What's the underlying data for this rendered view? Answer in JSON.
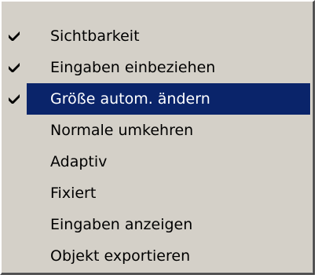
{
  "menu": {
    "items": [
      {
        "label": "Sichtbarkeit",
        "checked": true,
        "selected": false,
        "icon": "checkmark-icon"
      },
      {
        "label": "Eingaben einbeziehen",
        "checked": true,
        "selected": false,
        "icon": "checkmark-icon"
      },
      {
        "label": "Größe autom. ändern",
        "checked": true,
        "selected": true,
        "icon": "checkmark-icon"
      },
      {
        "label": "Normale umkehren",
        "checked": false,
        "selected": false
      },
      {
        "label": "Adaptiv",
        "checked": false,
        "selected": false
      },
      {
        "label": "Fixiert",
        "checked": false,
        "selected": false
      },
      {
        "label": "Eingaben anzeigen",
        "checked": false,
        "selected": false
      },
      {
        "label": "Objekt exportieren",
        "checked": false,
        "selected": false
      }
    ]
  },
  "colors": {
    "menu_background": "#d4d0c8",
    "selection_background": "#0a246a",
    "selection_text": "#ffffff",
    "text": "#000000"
  }
}
